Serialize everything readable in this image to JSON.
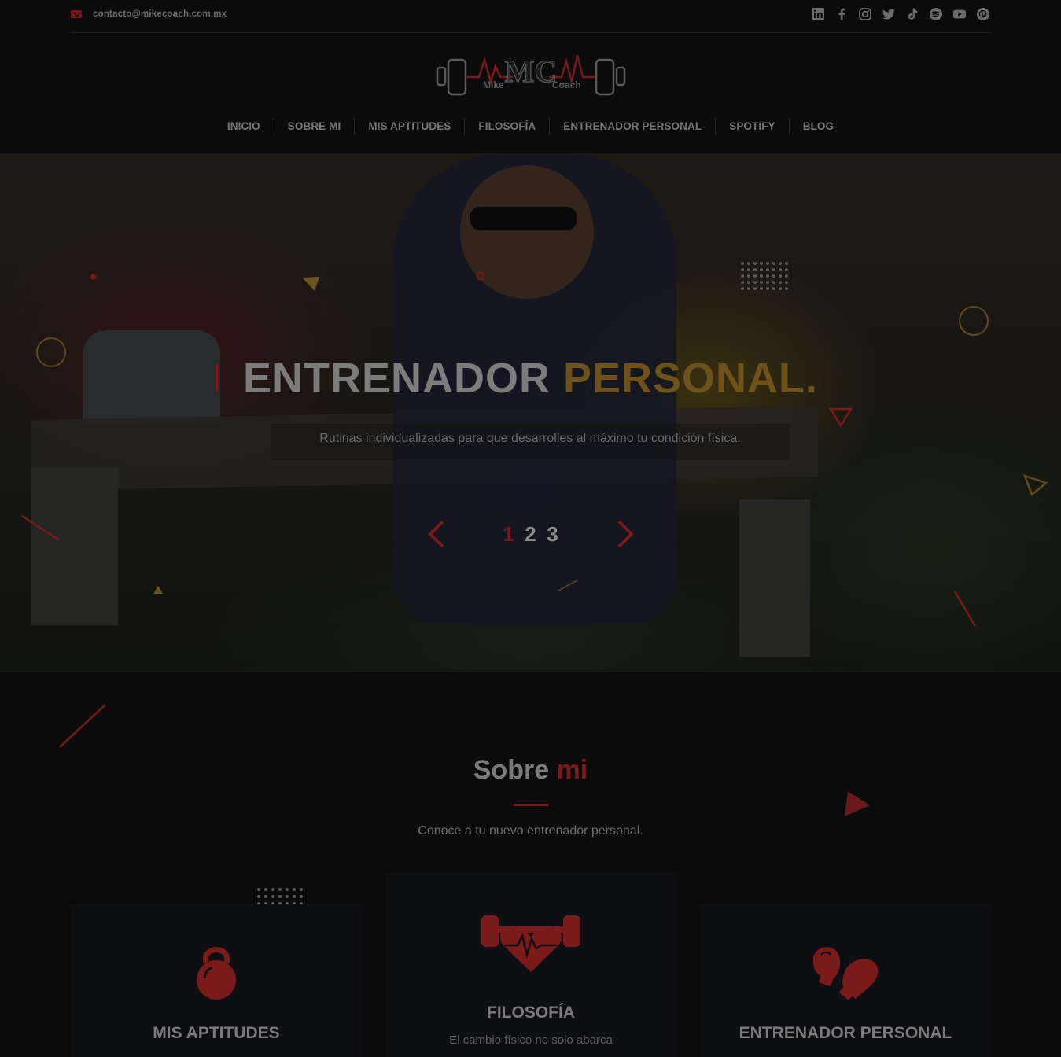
{
  "topbar": {
    "email": "contacto@mikecoach.com.mx",
    "social_icons": [
      "linkedin-icon",
      "facebook-icon",
      "instagram-icon",
      "twitter-icon",
      "tiktok-icon",
      "spotify-icon",
      "youtube-icon",
      "pinterest-icon"
    ]
  },
  "logo": {
    "left": "Mike",
    "right": "Coach",
    "mark": "MC"
  },
  "nav": {
    "items": [
      "INICIO",
      "SOBRE MI",
      "MIS APTITUDES",
      "FILOSOFÍA",
      "ENTRENADOR PERSONAL",
      "SPOTIFY",
      "BLOG"
    ]
  },
  "hero": {
    "title_word1": "ENTRENADOR",
    "title_word2": "PERSONAL.",
    "subtitle": "Rutinas individualizadas para que desarrolles al máximo tu condición física.",
    "slides": [
      "1",
      "2",
      "3"
    ],
    "active_slide": 1
  },
  "about": {
    "title_a": "Sobre",
    "title_b": "mi",
    "subtitle": "Conoce a tu nuevo entrenador personal."
  },
  "cards": [
    {
      "title": "MIS APTITUDES",
      "icon": "kettlebell-icon",
      "text": ""
    },
    {
      "title": "FILOSOFÍA",
      "icon": "heart-dumbbell-icon",
      "text": "El cambio físico no solo abarca"
    },
    {
      "title": "ENTRENADOR PERSONAL",
      "icon": "boxing-gloves-icon",
      "text": ""
    }
  ],
  "colors": {
    "accent": "#7a1a1a",
    "gold": "#6d5219",
    "background": "#0b0b0c",
    "card": "#0e0f12"
  }
}
